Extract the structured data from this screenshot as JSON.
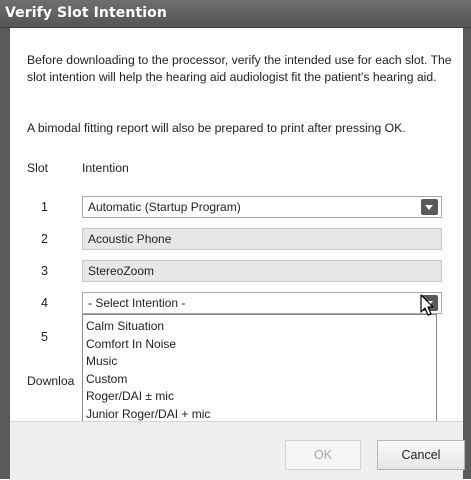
{
  "dialog": {
    "title": "Verify Slot Intention",
    "description": "Before downloading to the processor, verify the intended use for each slot. The slot intention will help the hearing aid audiologist fit the patient's hearing aid.",
    "report_note": "A bimodal fitting report will also be prepared to print after pressing OK.",
    "col_slot": "Slot",
    "col_intention": "Intention",
    "download_label": "Downloa"
  },
  "slots": [
    {
      "number": "1",
      "value": "Automatic (Startup Program)"
    },
    {
      "number": "2",
      "value": "Acoustic Phone"
    },
    {
      "number": "3",
      "value": "StereoZoom"
    },
    {
      "number": "4",
      "value": "- Select Intention -"
    },
    {
      "number": "5",
      "value": ""
    }
  ],
  "dropdown_options": [
    "Calm Situation",
    "Comfort In Noise",
    "Music",
    "Custom",
    "Roger/DAI ± mic",
    "Junior Roger/DAI + mic"
  ],
  "buttons": {
    "ok": "OK",
    "cancel": "Cancel"
  },
  "colors": {
    "titlebar": "#5f5f5f",
    "readonly_field": "#e7e7e7",
    "dropdown_button": "#595959"
  }
}
